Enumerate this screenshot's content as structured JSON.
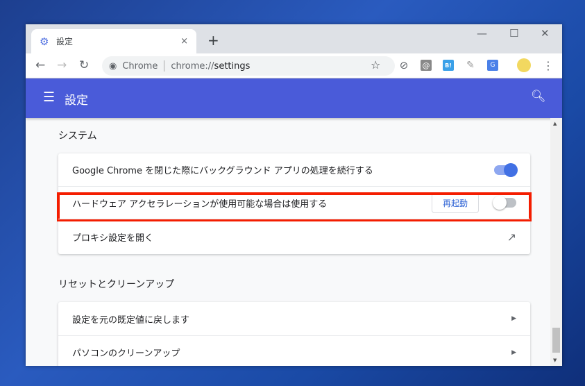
{
  "tab": {
    "title": "設定",
    "close": "×",
    "new_tab": "+"
  },
  "window_controls": {
    "minimize": "—",
    "maximize": "☐",
    "close": "✕"
  },
  "omnibox": {
    "site": "Chrome",
    "url_host": "chrome://",
    "url_path": "settings"
  },
  "header": {
    "title": "設定"
  },
  "sections": [
    {
      "title": "システム",
      "rows": [
        {
          "label": "Google Chrome を閉じた際にバックグラウンド アプリの処理を続行する",
          "toggle_on": true
        },
        {
          "label": "ハードウェア アクセラレーションが使用可能な場合は使用する",
          "button": "再起動",
          "toggle_on": false
        },
        {
          "label": "プロキシ設定を開く"
        }
      ]
    },
    {
      "title": "リセットとクリーンアップ",
      "rows": [
        {
          "label": "設定を元の既定値に戻します"
        },
        {
          "label": "パソコンのクリーンアップ"
        }
      ]
    }
  ],
  "colors": {
    "accent": "#4a5bd9",
    "highlight": "#f41d00",
    "toggle_on": "#4170e4"
  }
}
